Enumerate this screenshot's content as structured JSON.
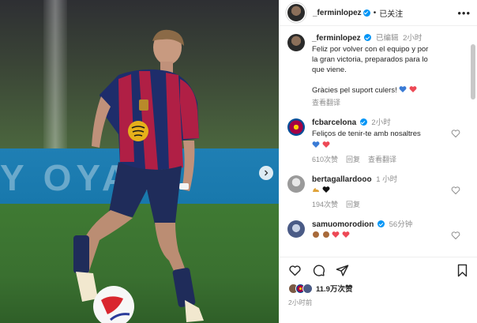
{
  "post": {
    "author": "_ferminlopez",
    "follow_label": "已关注",
    "caption_edited": "已编辑",
    "caption_time": "2小时",
    "caption_line1": "Feliz por volver con el equipo y por",
    "caption_line2": "la gran victoria, preparados para lo",
    "caption_line3": "que viene.",
    "caption_line4": "Gràcies pel suport culers!",
    "translate_label": "查看翻译"
  },
  "comments": [
    {
      "user": "fcbarcelona",
      "time": "2小时",
      "text": "Feliços de tenir-te amb nosaltres",
      "likes": "610次赞",
      "reply": "回复",
      "translate": "查看翻译"
    },
    {
      "user": "bertagallardooo",
      "time": "1 小时",
      "likes": "194次赞",
      "reply": "回复"
    },
    {
      "user": "samuomorodion",
      "time": "56分钟"
    }
  ],
  "footer": {
    "likes_count": "11.9万次赞",
    "posted_ago": "2小时前"
  },
  "photo": {
    "banner_text": "Y OYA A"
  },
  "colors": {
    "accent": "#0095f6",
    "heart_red": "#ed4956",
    "heart_blue": "#3a7bd5"
  }
}
